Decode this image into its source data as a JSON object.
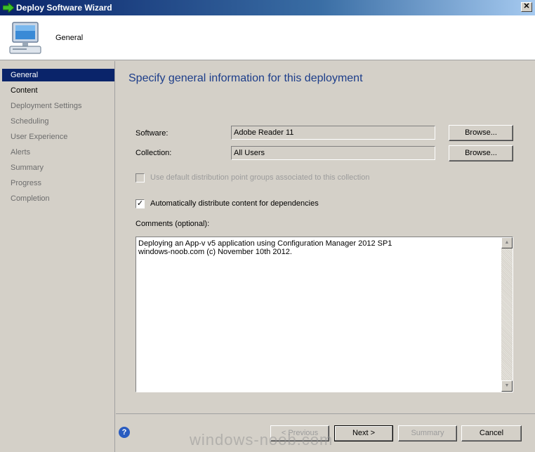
{
  "window": {
    "title": "Deploy Software Wizard",
    "close_glyph": "✕"
  },
  "header": {
    "title": "General"
  },
  "sidebar": {
    "items": [
      {
        "label": "General",
        "state": "active"
      },
      {
        "label": "Content",
        "state": "done"
      },
      {
        "label": "Deployment Settings",
        "state": "pending"
      },
      {
        "label": "Scheduling",
        "state": "pending"
      },
      {
        "label": "User Experience",
        "state": "pending"
      },
      {
        "label": "Alerts",
        "state": "pending"
      },
      {
        "label": "Summary",
        "state": "pending"
      },
      {
        "label": "Progress",
        "state": "pending"
      },
      {
        "label": "Completion",
        "state": "pending"
      }
    ]
  },
  "main": {
    "heading": "Specify general information for this deployment",
    "software": {
      "label": "Software:",
      "value": "Adobe Reader 11",
      "browse": "Browse..."
    },
    "collection": {
      "label": "Collection:",
      "value": "All Users",
      "browse": "Browse..."
    },
    "use_default_dp": {
      "label": "Use default distribution point groups associated to this collection",
      "checked": false,
      "enabled": false
    },
    "auto_distribute": {
      "label": "Automatically distribute content for dependencies",
      "checked": true,
      "check_glyph": "✓"
    },
    "comments": {
      "label": "Comments (optional):",
      "value": "Deploying an App-v v5 application using Configuration Manager 2012 SP1\nwindows-noob.com (c) November 10th 2012."
    }
  },
  "footer": {
    "help_glyph": "?",
    "previous": "< Previous",
    "next": "Next >",
    "summary": "Summary",
    "cancel": "Cancel"
  },
  "watermark": "windows-noob.com",
  "colors": {
    "title_bar": "#0a246a",
    "heading": "#1c3d8a",
    "nav_active": "#0a246a"
  }
}
